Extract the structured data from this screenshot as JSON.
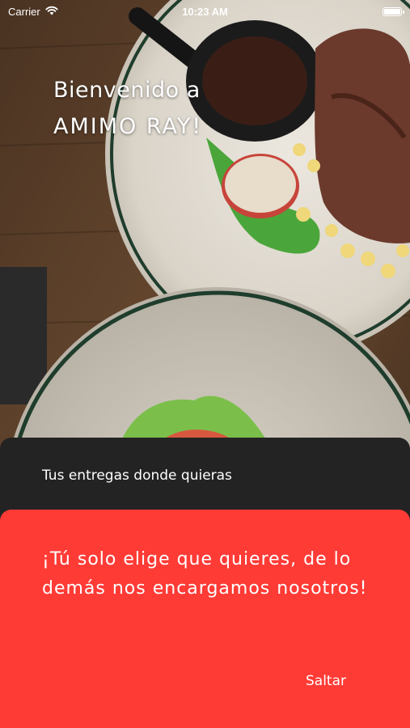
{
  "status_bar": {
    "carrier": "Carrier",
    "time": "10:23 AM"
  },
  "welcome": {
    "line1": "Bienvenido a",
    "brand": "AMIMO RAY!"
  },
  "panels": {
    "dark_text": "Tus entregas donde quieras",
    "red_text": "¡Tú solo elige que quieres, de lo demás nos encargamos nosotros!",
    "skip_label": "Saltar"
  },
  "colors": {
    "red_panel": "#ff3b36",
    "dark_panel": "#232323"
  },
  "icons": {
    "wifi": "wifi-icon",
    "battery": "battery-icon"
  },
  "background": "food-photo"
}
